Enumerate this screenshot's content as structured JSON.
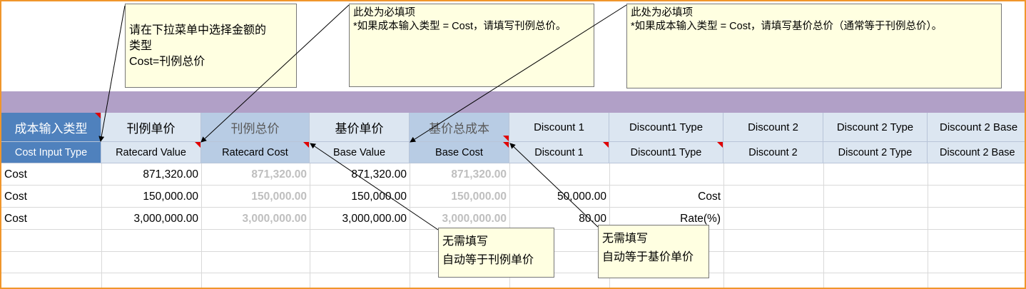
{
  "header_row1": {
    "col_a": "成本输入类型",
    "col_b": "刊例单价",
    "col_c": "刊例总价",
    "col_d": "基价单价",
    "col_e": "基价总成本",
    "col_f": "Discount 1",
    "col_g": "Discount1 Type",
    "col_h": "Discount 2",
    "col_i": "Discount 2 Type",
    "col_j": "Discount 2  Base"
  },
  "header_row2": {
    "col_a": "Cost Input Type",
    "col_b": "Ratecard Value",
    "col_c": "Ratecard Cost",
    "col_d": "Base Value",
    "col_e": "Base Cost",
    "col_f": "Discount 1",
    "col_g": "Discount1 Type",
    "col_h": "Discount 2",
    "col_i": "Discount 2 Type",
    "col_j": "Discount 2  Base"
  },
  "rows": [
    {
      "type": "Cost",
      "ratecard_value": "871,320.00",
      "ratecard_cost": "871,320.00",
      "base_value": "871,320.00",
      "base_cost": "871,320.00",
      "discount1": "",
      "discount1_type": ""
    },
    {
      "type": "Cost",
      "ratecard_value": "150,000.00",
      "ratecard_cost": "150,000.00",
      "base_value": "150,000.00",
      "base_cost": "150,000.00",
      "discount1": "50,000.00",
      "discount1_type": "Cost"
    },
    {
      "type": "Cost",
      "ratecard_value": "3,000,000.00",
      "ratecard_cost": "3,000,000.00",
      "base_value": "3,000,000.00",
      "base_cost": "3,000,000.00",
      "discount1": "80.00",
      "discount1_type": "Rate(%)"
    }
  ],
  "notes": {
    "select_type": {
      "line1": "请在下拉菜单中选择金额的",
      "line2": "类型",
      "line3": "Cost=刊例总价"
    },
    "ratecard_required": {
      "line1": "此处为必填项",
      "line2": "*如果成本输入类型 = Cost，请填写刊例总价。"
    },
    "base_required": {
      "line1": "此处为必填项",
      "line2": "*如果成本输入类型 = Cost，请填写基价总价（通常等于刊例总价）。"
    },
    "auto_ratecard": {
      "line1": "无需填写",
      "line2": "自动等于刊例单价"
    },
    "auto_base": {
      "line1": "无需填写",
      "line2": "自动等于基价单价"
    }
  },
  "colors": {
    "frame": "#f0962b",
    "band": "#b1a0c7",
    "header_light": "#dce6f1",
    "header_dark": "#b8cce4",
    "header_accent": "#4f81bd",
    "note_bg": "#ffffe1",
    "comment_flag": "#e00000"
  }
}
